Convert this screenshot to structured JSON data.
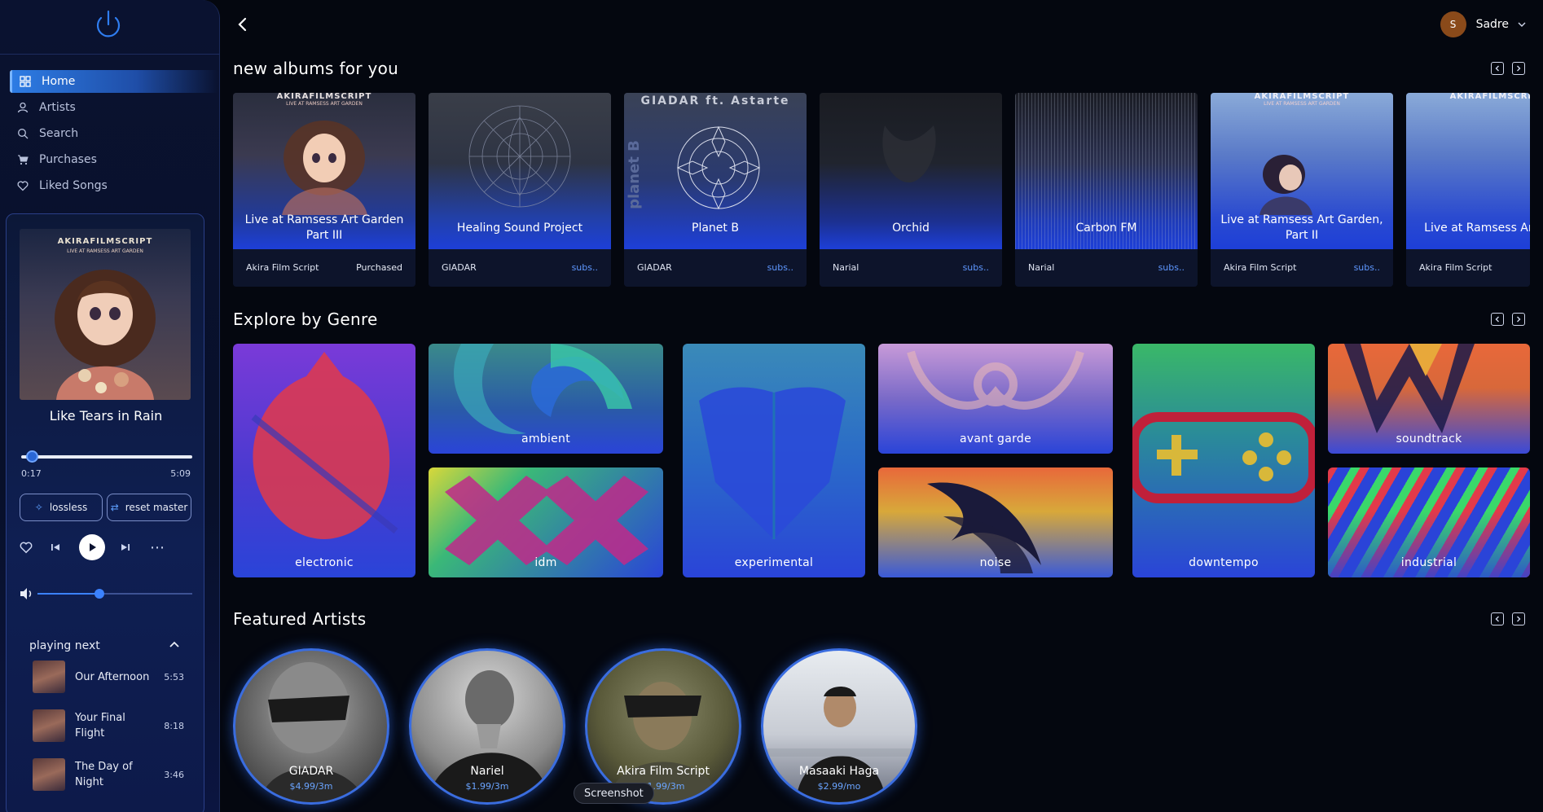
{
  "app": {
    "name": "music player"
  },
  "sidebar": {
    "nav": [
      {
        "label": "Home",
        "icon": "grid-icon",
        "active": true
      },
      {
        "label": "Artists",
        "icon": "user-icon",
        "active": false
      },
      {
        "label": "Search",
        "icon": "search-icon",
        "active": false
      },
      {
        "label": "Purchases",
        "icon": "cart-icon",
        "active": false
      },
      {
        "label": "Liked Songs",
        "icon": "heart-icon",
        "active": false
      }
    ]
  },
  "player": {
    "cover_text": "AKIRAFILMSCRIPT",
    "cover_subtext": "LIVE AT RAMSESS ART GARDEN",
    "track_title": "Like Tears in Rain",
    "current_time": "0:17",
    "total_time": "5:09",
    "progress_fraction": 0.055,
    "lossless_label": "lossless",
    "reset_label": "reset master",
    "volume_fraction": 0.4,
    "playing_next_label": "playing next",
    "queue": [
      {
        "title": "Our Afternoon",
        "duration": "5:53"
      },
      {
        "title": "Your Final Flight",
        "duration": "8:18"
      },
      {
        "title": "The Day of Night",
        "duration": "3:46"
      }
    ]
  },
  "header": {
    "user_initial": "S",
    "user_name": "Sadre"
  },
  "sections": {
    "albums_title": "new albums for you",
    "genres_title": "Explore by Genre",
    "artists_title": "Featured Artists"
  },
  "albums": [
    {
      "title": "Live at Ramsess Art Garden Part III",
      "artist": "Akira Film Script",
      "badge": "Purchased"
    },
    {
      "title": "Healing Sound Project",
      "artist": "GIADAR",
      "badge": "subs.."
    },
    {
      "title": "Planet B",
      "artist": "GIADAR",
      "badge": "subs.."
    },
    {
      "title": "Orchid",
      "artist": "Narial",
      "badge": "subs.."
    },
    {
      "title": "Carbon FM",
      "artist": "Narial",
      "badge": "subs.."
    },
    {
      "title": "Live at Ramsess Art Garden, Part II",
      "artist": "Akira Film Script",
      "badge": "subs.."
    },
    {
      "title": "Live at Ramsess Art Part I",
      "artist": "Akira Film Script",
      "badge": ""
    }
  ],
  "album_art_text": {
    "akira_header": "AKIRAFILMSCRIPT",
    "akira_sub": "LIVE AT RAMSESS ART GARDEN",
    "giadar_header": "GIADAR ft. Astarte",
    "planet_vertical": "planet B"
  },
  "genres": [
    {
      "name": "electronic"
    },
    {
      "name": "ambient"
    },
    {
      "name": "idm"
    },
    {
      "name": "experimental"
    },
    {
      "name": "avant garde"
    },
    {
      "name": "noise"
    },
    {
      "name": "downtempo"
    },
    {
      "name": "soundtrack"
    },
    {
      "name": "industrial"
    }
  ],
  "artists": [
    {
      "name": "GIADAR",
      "price": "$4.99/3m"
    },
    {
      "name": "Nariel",
      "price": "$1.99/3m"
    },
    {
      "name": "Akira Film Script",
      "price": "$1.99/3m"
    },
    {
      "name": "Masaaki Haga",
      "price": "$2.99/mo"
    }
  ],
  "tooltip": "Screenshot",
  "colors": {
    "accent": "#2d7ce4",
    "subs": "#5e97ff",
    "price": "#6aa4ff"
  }
}
